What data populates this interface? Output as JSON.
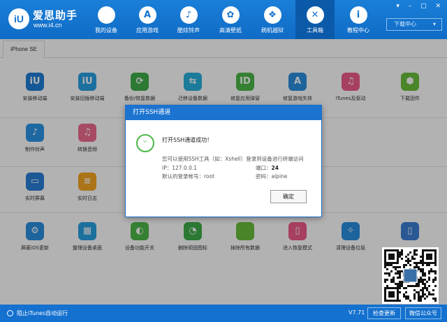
{
  "header": {
    "brand": "爱思助手",
    "site": "www.i4.cn",
    "window_controls": "▾ – □ ✕",
    "download_center": "下载中心",
    "download_arrow": "▾",
    "nav": [
      {
        "label": "我的设备",
        "icon": "apple-icon",
        "glyph": ""
      },
      {
        "label": "应用游戏",
        "icon": "app-store-icon",
        "glyph": "A"
      },
      {
        "label": "酷炫铃声",
        "icon": "bell-icon",
        "glyph": "♪"
      },
      {
        "label": "高清壁纸",
        "icon": "wallpaper-icon",
        "glyph": "✿"
      },
      {
        "label": "刷机越狱",
        "icon": "dropbox-icon",
        "glyph": "❖"
      },
      {
        "label": "工具箱",
        "icon": "toolbox-icon",
        "glyph": "✕"
      },
      {
        "label": "教程中心",
        "icon": "info-icon",
        "glyph": "i"
      }
    ]
  },
  "device_tab": "iPhone SE",
  "tools": [
    {
      "label": "安装移动端",
      "icon": "i4-mobile-icon",
      "glyph": "iU",
      "color": "#1f7fd6"
    },
    {
      "label": "安装旧版移动端",
      "icon": "i4-legacy-icon",
      "glyph": "iU",
      "color": "#29a1e3"
    },
    {
      "label": "备份/恢复数据",
      "icon": "backup-icon",
      "glyph": "⟳",
      "color": "#3fae49"
    },
    {
      "label": "迁移设备数据",
      "icon": "migrate-icon",
      "glyph": "⇆",
      "color": "#27b1dc"
    },
    {
      "label": "修复应用弹窗",
      "icon": "apple-id-icon",
      "glyph": "ID",
      "color": "#4cb848"
    },
    {
      "label": "修复游戏失效",
      "icon": "appstore-fix-icon",
      "glyph": "A",
      "color": "#2a8fe0"
    },
    {
      "label": "iTunes及驱动",
      "icon": "itunes-icon",
      "glyph": "♫",
      "color": "#ef5b8a"
    },
    {
      "label": "下载固件",
      "icon": "firmware-icon",
      "glyph": "⬢",
      "color": "#6cbf3c"
    },
    {
      "label": "制作铃声",
      "icon": "ringtone-icon",
      "glyph": "♪",
      "color": "#2b96e8"
    },
    {
      "label": "转换音频",
      "icon": "audio-convert-icon",
      "glyph": "♫",
      "color": "#ef6b8f"
    },
    {
      "label": "实时屏幕",
      "icon": "screen-icon",
      "glyph": "▭",
      "color": "#2a7fd8"
    },
    {
      "label": "实时日志",
      "icon": "log-icon",
      "glyph": "≡",
      "color": "#f5a623"
    },
    {
      "label": "屏蔽iOS更新",
      "icon": "block-update-icon",
      "glyph": "⚙",
      "color": "#2a8fe0"
    },
    {
      "label": "整理设备桌面",
      "icon": "desktop-icon",
      "glyph": "▦",
      "color": "#29a1e3"
    },
    {
      "label": "设备功能开关",
      "icon": "toggle-icon",
      "glyph": "◐",
      "color": "#4cb848"
    },
    {
      "label": "删除顽固图标",
      "icon": "delete-icon",
      "glyph": "◔",
      "color": "#3fae49"
    },
    {
      "label": "抹除所有数据",
      "icon": "erase-icon",
      "glyph": "",
      "color": "#6cbf3c"
    },
    {
      "label": "进入恢复模式",
      "icon": "recovery-icon",
      "glyph": "▯",
      "color": "#ef5b8a"
    },
    {
      "label": "清理设备垃圾",
      "icon": "clean-icon",
      "glyph": "✧",
      "color": "#2a8fe0"
    },
    {
      "label": "",
      "icon": "more-icon",
      "glyph": "▯",
      "color": "#3d7fd6"
    }
  ],
  "dialog": {
    "title": "打开SSH通道",
    "icon": "smile-icon",
    "message": "打开SSH通道成功！",
    "line1": "您可以使用SSH工具（如：Xshell）登录到设备进行终端访问",
    "ip": "IP：127.0.0.1",
    "port_label": "端口：",
    "port_value": "24",
    "account": "默认的登录帐号：root",
    "password": "密码：alpine",
    "ok": "确定"
  },
  "status": {
    "itunes": "阻止iTunes自动运行",
    "version": "V7.71",
    "check_update": "检查更新",
    "wechat": "微信公众号"
  }
}
